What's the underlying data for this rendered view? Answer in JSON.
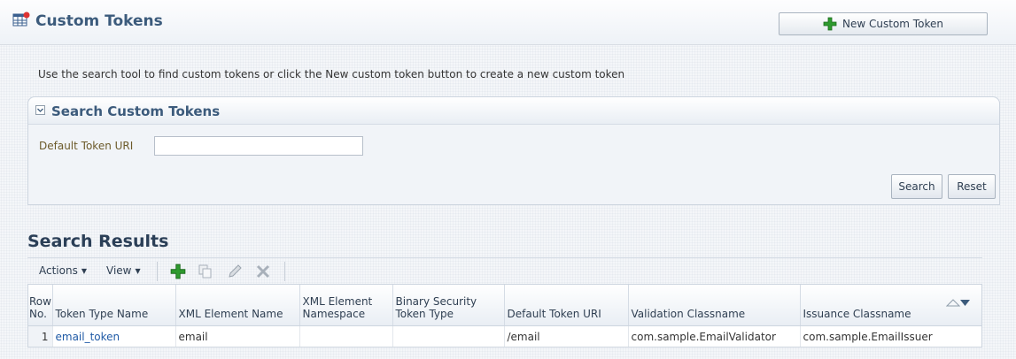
{
  "header": {
    "title": "Custom Tokens",
    "new_button_label": "New Custom Token"
  },
  "instructions": "Use the search tool to find custom tokens or click the New custom token button to create a new custom token",
  "search": {
    "title": "Search Custom Tokens",
    "field_label": "Default Token URI",
    "field_value": "",
    "search_label": "Search",
    "reset_label": "Reset"
  },
  "results": {
    "title": "Search Results",
    "toolbar": {
      "actions_label": "Actions",
      "view_label": "View"
    },
    "columns": [
      "Row No.",
      "Token Type Name",
      "XML Element Name",
      "XML Element Namespace",
      "Binary Security Token Type",
      "Default Token URI",
      "Validation Classname",
      "Issuance Classname"
    ],
    "column_header_lines": {
      "row_no_1": "Row",
      "row_no_2": "No.",
      "ns_1": "XML Element",
      "ns_2": "Namespace",
      "bst_1": "Binary Security",
      "bst_2": "Token Type"
    },
    "rows": [
      {
        "row_no": "1",
        "token_type_name": "email_token",
        "xml_element_name": "email",
        "xml_element_namespace": "",
        "binary_security_token_type": "",
        "default_token_uri": "/email",
        "validation_classname": "com.sample.EmailValidator",
        "issuance_classname": "com.sample.EmailIssuer"
      }
    ]
  },
  "colors": {
    "title": "#3c5b7c",
    "link": "#1f5aa6",
    "add_green": "#2e9a2e"
  },
  "icons": [
    "table-icon",
    "add-icon",
    "duplicate-icon",
    "edit-icon",
    "delete-icon",
    "sort-icon",
    "collapse-icon"
  ]
}
